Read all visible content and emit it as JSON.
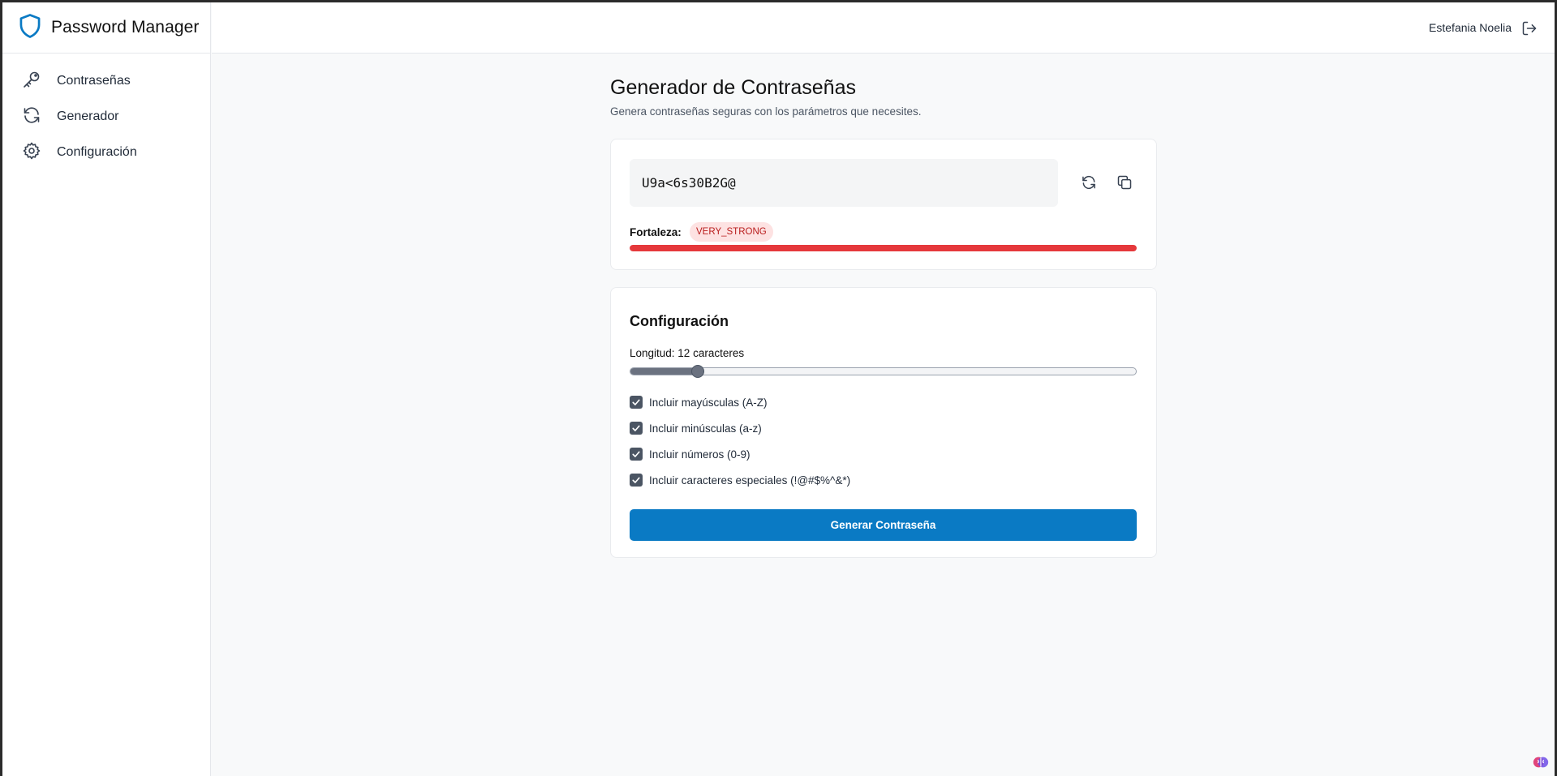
{
  "app": {
    "title": "Password Manager"
  },
  "sidebar": {
    "items": [
      {
        "label": "Contraseñas",
        "icon": "key-icon"
      },
      {
        "label": "Generador",
        "icon": "refresh-icon"
      },
      {
        "label": "Configuración",
        "icon": "gear-icon"
      }
    ]
  },
  "header": {
    "user": "Estefania Noelia",
    "logout_icon": "logout-icon"
  },
  "main": {
    "title": "Generador de Contraseñas",
    "subtitle": "Genera contraseñas seguras con los parámetros que necesites."
  },
  "password": {
    "value": "U9a<6s30B2G@",
    "strength_label": "Fortaleza:",
    "strength_value": "VERY_STRONG",
    "strength_fraction": 1.0,
    "strength_color": "#e5383b"
  },
  "config": {
    "title": "Configuración",
    "length_label": "Longitud: 12 caracteres",
    "length": 12,
    "length_min": 4,
    "length_max": 64,
    "options": [
      {
        "label": "Incluir mayúsculas (A-Z)",
        "checked": true
      },
      {
        "label": "Incluir minúsculas (a-z)",
        "checked": true
      },
      {
        "label": "Incluir números (0-9)",
        "checked": true
      },
      {
        "label": "Incluir caracteres especiales (!@#$%^&*)",
        "checked": true
      }
    ],
    "generate_label": "Generar Contraseña"
  },
  "colors": {
    "accent": "#0a7ac4",
    "brand": "#0a7ac4"
  }
}
